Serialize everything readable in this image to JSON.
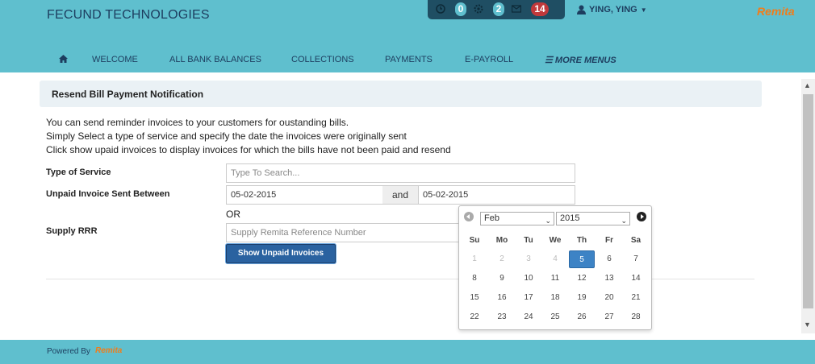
{
  "header": {
    "brand": "FECUND TECHNOLOGIES",
    "notifications": {
      "alerts": "0",
      "messages": "2",
      "mail": "14"
    },
    "user_name": "YING, YING",
    "logo_text": "Remita"
  },
  "nav": {
    "items": [
      "WELCOME",
      "ALL BANK BALANCES",
      "COLLECTIONS",
      "PAYMENTS",
      "E-PAYROLL",
      "MORE MENUS"
    ]
  },
  "panel": {
    "title": "Resend Bill Payment Notification",
    "intro": [
      "You can send reminder invoices to your customers for oustanding bills.",
      "Simply Select a type of service and specify the date the invoices were originally sent",
      "Click show upaid invoices to display invoices for which the bills have not been paid and resend"
    ]
  },
  "form": {
    "service_label": "Type of Service",
    "service_placeholder": "Type To Search...",
    "date_label": "Unpaid Invoice Sent Between",
    "date_from": "05-02-2015",
    "and_text": "and",
    "date_to": "05-02-2015",
    "or_text": "OR",
    "rrr_label": "Supply RRR",
    "rrr_placeholder": "Supply Remita Reference Number",
    "submit_label": "Show Unpaid Invoices"
  },
  "calendar": {
    "month": "Feb",
    "year": "2015",
    "weekdays": [
      "Su",
      "Mo",
      "Tu",
      "We",
      "Th",
      "Fr",
      "Sa"
    ],
    "weeks": [
      [
        "1",
        "2",
        "3",
        "4",
        "5",
        "6",
        "7"
      ],
      [
        "8",
        "9",
        "10",
        "11",
        "12",
        "13",
        "14"
      ],
      [
        "15",
        "16",
        "17",
        "18",
        "19",
        "20",
        "21"
      ],
      [
        "22",
        "23",
        "24",
        "25",
        "26",
        "27",
        "28"
      ]
    ],
    "selected_day": "5",
    "disabled_days": [
      "1",
      "2",
      "3",
      "4"
    ]
  },
  "footer": {
    "powered_by": "Powered By",
    "logo_text": "Remita"
  }
}
